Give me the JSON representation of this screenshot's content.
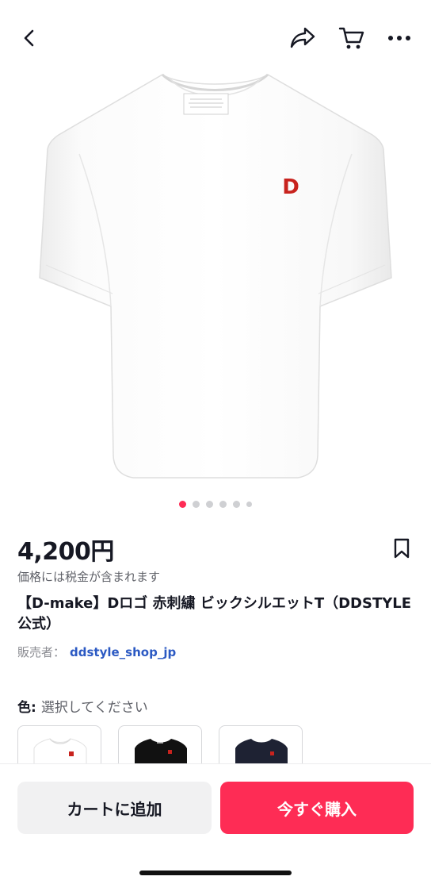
{
  "header": {
    "back_icon": "chevron-left-icon",
    "share_icon": "share-arrow-icon",
    "cart_icon": "cart-icon",
    "more_icon": "more-dots-icon"
  },
  "gallery": {
    "image_count": 6,
    "active_index": 0,
    "image_label": "D"
  },
  "product": {
    "price": "4,200円",
    "tax_note": "価格には税金が含まれます",
    "title": "【D-make】Dロゴ 赤刺繍 ビックシルエットT（DDSTYLE公式）",
    "seller_label": "販売者：",
    "seller_name": "ddstyle_shop_jp"
  },
  "variants": {
    "label": "色:",
    "placeholder": "選択してください",
    "options": [
      {
        "color": "#ffffff"
      },
      {
        "color": "#111111"
      },
      {
        "color": "#1e2233"
      }
    ]
  },
  "actions": {
    "cart_label": "カートに追加",
    "buy_label": "今すぐ購入"
  },
  "colors": {
    "accent": "#fe2c55",
    "link": "#2b59c3",
    "logo_red": "#c8231e"
  }
}
